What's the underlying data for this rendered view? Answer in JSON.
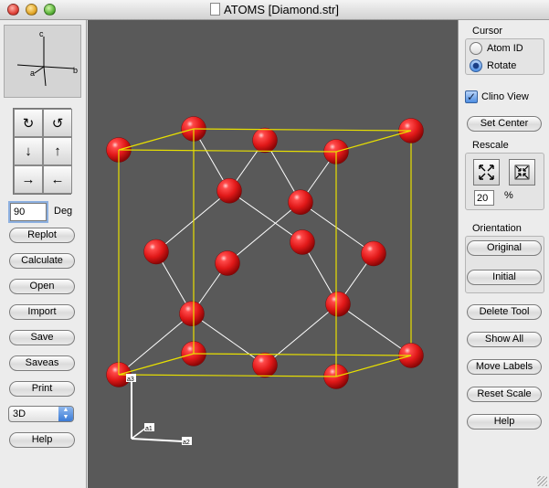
{
  "window": {
    "title": "ATOMS [Diamond.str]"
  },
  "axes_widget": {
    "labels": [
      "c",
      "a",
      "b"
    ]
  },
  "rotation_buttons": [
    {
      "icon": "rotate-cw-icon",
      "glyph": "↻"
    },
    {
      "icon": "rotate-ccw-icon",
      "glyph": "↺"
    },
    {
      "icon": "arrow-down-icon",
      "glyph": "↓"
    },
    {
      "icon": "arrow-up-icon",
      "glyph": "↑"
    },
    {
      "icon": "arrow-right-icon",
      "glyph": "→"
    },
    {
      "icon": "arrow-left-icon",
      "glyph": "←"
    }
  ],
  "degree": {
    "value": "90",
    "label": "Deg"
  },
  "left_buttons": {
    "replot": "Replot",
    "calculate": "Calculate",
    "open": "Open",
    "import": "Import",
    "save": "Save",
    "saveas": "Saveas",
    "print": "Print",
    "help": "Help"
  },
  "view_mode": {
    "selected": "3D"
  },
  "cursor": {
    "title": "Cursor",
    "atom_id": "Atom ID",
    "rotate": "Rotate",
    "selected": "Rotate"
  },
  "clino_view": {
    "label": "Clino View",
    "checked": true
  },
  "right_buttons": {
    "set_center": "Set Center",
    "delete_tool": "Delete Tool",
    "show_all": "Show All",
    "move_labels": "Move Labels",
    "reset_scale": "Reset Scale",
    "help": "Help"
  },
  "rescale": {
    "title": "Rescale",
    "value": "20",
    "unit": "%"
  },
  "orientation": {
    "title": "Orientation",
    "original": "Original",
    "initial": "Initial"
  },
  "axis_labels": {
    "a1": "a1",
    "a2": "a2",
    "a3": "a3"
  },
  "colors": {
    "atom": "#e01818",
    "cell": "#e8e000",
    "background": "#595959",
    "bond": "#ffffff"
  }
}
